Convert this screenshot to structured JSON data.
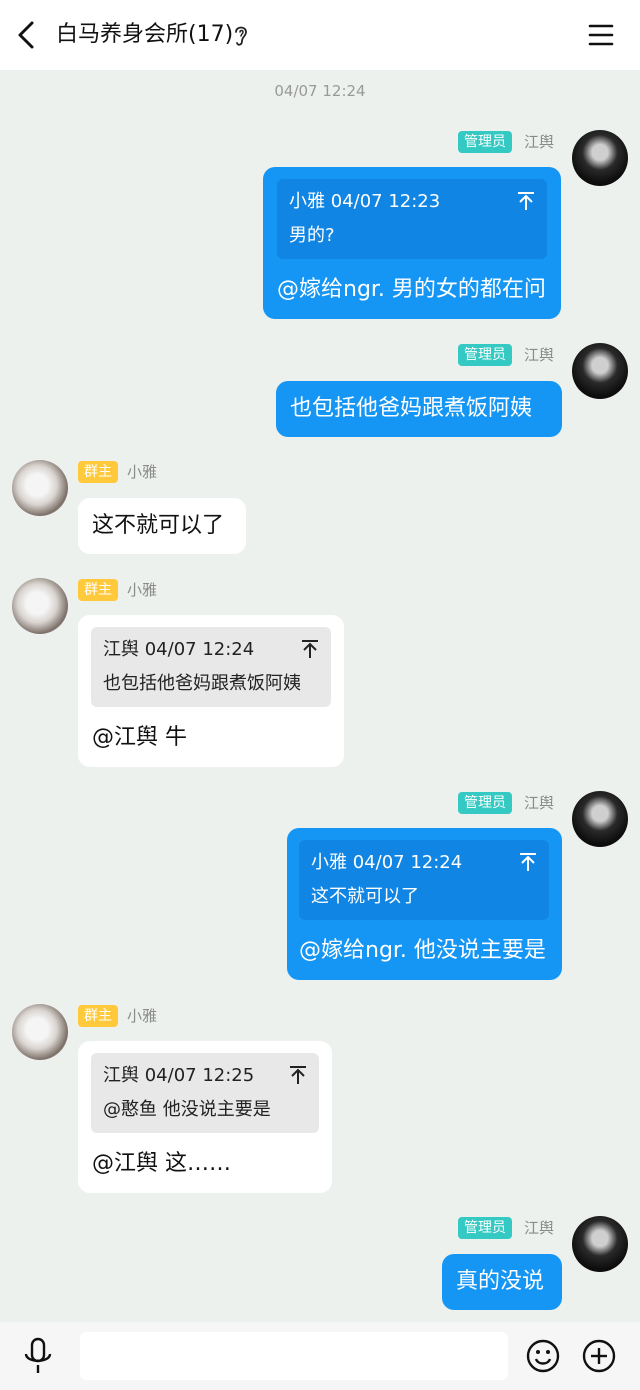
{
  "header": {
    "title": "白马养身会所(17)"
  },
  "timestamp": "04/07 12:24",
  "roles": {
    "admin": "管理员",
    "owner": "群主"
  },
  "users": {
    "admin": "江舆",
    "owner": "小雅"
  },
  "messages": [
    {
      "quote_header": "小雅 04/07 12:23",
      "quote_text": "男的?",
      "text": "@嫁给ngr. 男的女的都在问"
    },
    {
      "text": "也包括他爸妈跟煮饭阿姨"
    },
    {
      "text": "这不就可以了"
    },
    {
      "quote_header": "江舆 04/07 12:24",
      "quote_text": "也包括他爸妈跟煮饭阿姨",
      "text": "@江舆 牛"
    },
    {
      "quote_header": "小雅 04/07 12:24",
      "quote_text": "这不就可以了",
      "text": "@嫁给ngr. 他没说主要是"
    },
    {
      "quote_header": "江舆 04/07 12:25",
      "quote_text": "@憨鱼 他没说主要是",
      "text": "@江舆 这……"
    },
    {
      "text": "真的没说"
    }
  ],
  "colors": {
    "out_bubble": "#1596f5",
    "admin_badge": "#34c9c2",
    "owner_badge": "#ffc93c",
    "background": "#edf1ee"
  }
}
